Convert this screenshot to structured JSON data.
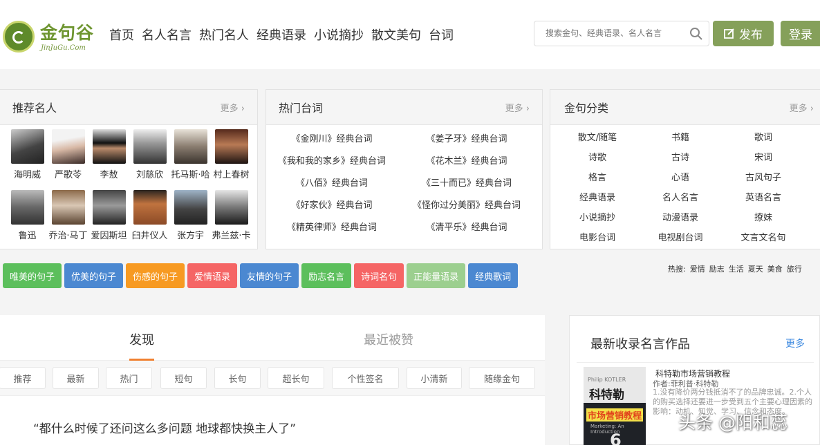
{
  "header": {
    "logo_text": "金句谷",
    "logo_sub": "JinJuGu.Com",
    "nav": [
      "首页",
      "名人名言",
      "热门名人",
      "经典语录",
      "小说摘抄",
      "散文美句",
      "台词"
    ],
    "search_placeholder": "搜索金句、经典语录、名人名言",
    "publish_label": "发布",
    "login_label": "登录"
  },
  "celebs_panel": {
    "title": "推荐名人",
    "more": "更多",
    "items": [
      "海明威",
      "严歌苓",
      "李敖",
      "刘慈欣",
      "托马斯·哈",
      "村上春树",
      "鲁迅",
      "乔治·马丁",
      "爱因斯坦",
      "臼井仪人",
      "张方宇",
      "弗兰兹·卡"
    ]
  },
  "lines_panel": {
    "title": "热门台词",
    "more": "更多",
    "items": [
      "《金刚川》经典台词",
      "《姜子牙》经典台词",
      "《我和我的家乡》经典台词",
      "《花木兰》经典台词",
      "《八佰》经典台词",
      "《三十而已》经典台词",
      "《好家伙》经典台词",
      "《怪你过分美丽》经典台词",
      "《精英律师》经典台词",
      "《清平乐》经典台词"
    ]
  },
  "cats_panel": {
    "title": "金句分类",
    "more": "更多",
    "items": [
      "散文/随笔",
      "书籍",
      "歌词",
      "诗歌",
      "古诗",
      "宋词",
      "格言",
      "心语",
      "古风句子",
      "经典语录",
      "名人名言",
      "英语名言",
      "小说摘抄",
      "动漫语录",
      "撩妹",
      "电影台词",
      "电视剧台词",
      "文言文名句"
    ]
  },
  "tags": [
    {
      "label": "唯美的句子",
      "color": "#5cbf5c"
    },
    {
      "label": "优美的句子",
      "color": "#4b88d1"
    },
    {
      "label": "伤感的句子",
      "color": "#f79a22"
    },
    {
      "label": "爱情语录",
      "color": "#f56565"
    },
    {
      "label": "友情的句子",
      "color": "#4b88d1"
    },
    {
      "label": "励志名言",
      "color": "#5cbf5c"
    },
    {
      "label": "诗词名句",
      "color": "#f56565"
    },
    {
      "label": "正能量语录",
      "color": "#9ccf8f"
    },
    {
      "label": "经典歌词",
      "color": "#4b88d1"
    }
  ],
  "hot_search": {
    "label": "热搜:",
    "items": [
      "爱情",
      "励志",
      "生活",
      "夏天",
      "美食",
      "旅行"
    ]
  },
  "feed": {
    "tab_active": "发现",
    "tab_inactive": "最近被赞",
    "filters": [
      "推荐",
      "最新",
      "热门",
      "短句",
      "长句",
      "超长句",
      "个性签名",
      "小清新",
      "随缘金句"
    ],
    "quote": "“都什么时候了还问这么多问题 地球都快换主人了”"
  },
  "sidebar": {
    "title": "最新收录名言作品",
    "more": "更多",
    "book": {
      "title": "科特勒市场营销教程",
      "author": "作者:菲利普·科特勒",
      "desc": "1.没有降价两分钱抵消不了的品牌忠诚。2.个人的购买选择还要进一步受到五个主要心理因素的影响：动机、知觉、学习、信念和态度。",
      "cover_kotler": "Philip KOTLER",
      "cover_title": "科特勒",
      "cover_subtitle": "市场营销教程",
      "cover_en": "Marketing: An Introduction",
      "cover_number": "6"
    }
  },
  "watermark": "头条 @阳和蕊",
  "colors": {
    "brand_green": "#85a05a",
    "link_blue": "#3e8ae0",
    "tab_orange": "#f08030"
  }
}
